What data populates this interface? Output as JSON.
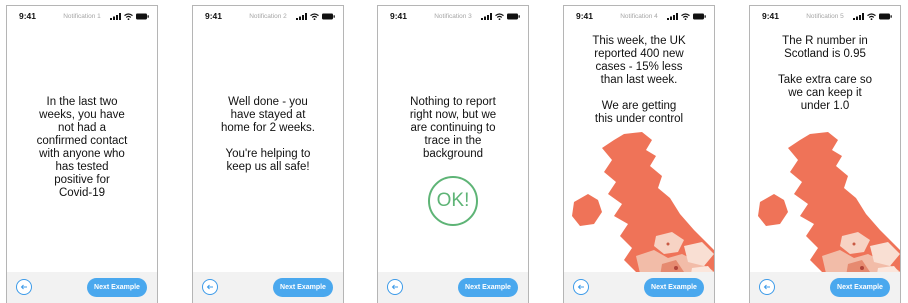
{
  "status_bar": {
    "time": "9:41"
  },
  "footer": {
    "back_icon": "arrow-left-icon",
    "next_label": "Next Example"
  },
  "colors": {
    "accent": "#4aa8ee",
    "ok_green": "#5eb476",
    "map_orange": "#ef7358"
  },
  "screens": [
    {
      "title": "Notification 1",
      "message": "In the last two\nweeks, you have\nnot had a\nconfirmed contact\nwith anyone who\nhas tested\npositive for\nCovid-19"
    },
    {
      "title": "Notification 2",
      "message": "Well done - you\nhave stayed at\nhome for 2 weeks.\n\nYou're helping to\nkeep us all safe!"
    },
    {
      "title": "Notification 3",
      "message": "Nothing to report\nright now, but we\nare continuing to\ntrace in the\nbackground",
      "badge": "OK!"
    },
    {
      "title": "Notification 4",
      "message": "This week, the UK\nreported 400 new\ncases - 15% less\nthan last week.\n\nWe are getting\nthis under control",
      "graphic": "uk-map"
    },
    {
      "title": "Notification 5",
      "message": "The R number in\nScotland is 0.95\n\nTake extra care so\nwe can keep it\nunder 1.0",
      "graphic": "uk-map"
    }
  ]
}
